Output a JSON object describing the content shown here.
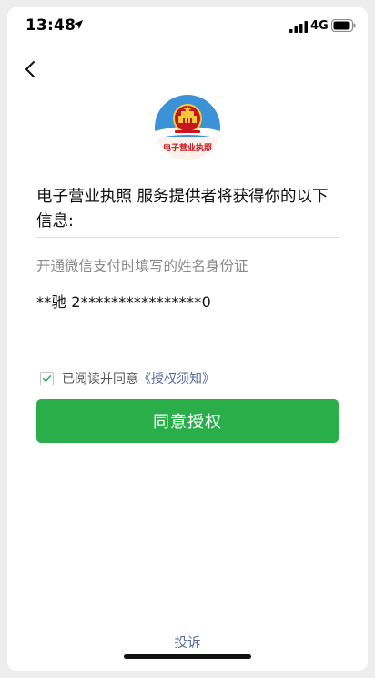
{
  "status_bar": {
    "time": "13:48",
    "network": "4G"
  },
  "navigation": {
    "back_icon": "chevron-left-icon"
  },
  "emblem": {
    "icon": "national-emblem-logo",
    "caption": "电子营业执照"
  },
  "auth": {
    "title": "电子营业执照 服务提供者将获得你的以下信息:",
    "info_label": "开通微信支付时填写的姓名身份证",
    "info_value": "**驰 2****************0"
  },
  "agreement": {
    "checked": true,
    "prefix": "已阅读并同意",
    "link": "《授权须知》"
  },
  "primary_button": {
    "label": "同意授权"
  },
  "footer": {
    "complain": "投诉"
  },
  "colors": {
    "accent": "#2aae4a",
    "link": "#576b95",
    "emblem_blue": "#3c92d6",
    "emblem_red": "#c7161e",
    "emblem_gold": "#f4c838"
  }
}
